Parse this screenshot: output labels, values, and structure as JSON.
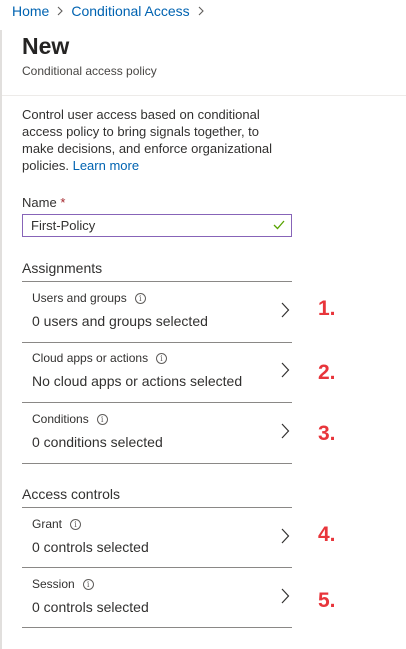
{
  "breadcrumb": {
    "items": [
      "Home",
      "Conditional Access"
    ]
  },
  "header": {
    "title": "New",
    "subtitle": "Conditional access policy"
  },
  "description": {
    "text": "Control user access based on conditional access policy to bring signals together, to make decisions, and enforce organizational policies.",
    "link": "Learn more"
  },
  "name_field": {
    "label": "Name",
    "required_mark": "*",
    "value": "First-Policy"
  },
  "assignments": {
    "title": "Assignments",
    "rows": [
      {
        "label": "Users and groups",
        "value": "0 users and groups selected"
      },
      {
        "label": "Cloud apps or actions",
        "value": "No cloud apps or actions selected"
      },
      {
        "label": "Conditions",
        "value": "0 conditions selected"
      }
    ]
  },
  "access_controls": {
    "title": "Access controls",
    "rows": [
      {
        "label": "Grant",
        "value": "0 controls selected"
      },
      {
        "label": "Session",
        "value": "0 controls selected"
      }
    ]
  },
  "annotations": [
    "1.",
    "2.",
    "3.",
    "4.",
    "5."
  ],
  "colors": {
    "link": "#0063b1",
    "input_border": "#8764b8",
    "check": "#57a300",
    "annotation": "#e8353b"
  },
  "icons": [
    "chevron-right-icon",
    "info-icon",
    "checkmark-icon"
  ]
}
